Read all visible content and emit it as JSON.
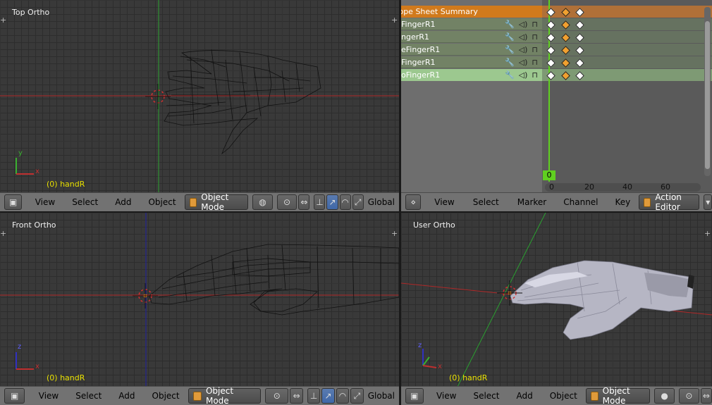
{
  "viewports": {
    "top_left": {
      "label": "Top Ortho",
      "object": "(0) handR",
      "axes": {
        "y": "y",
        "x": "x"
      }
    },
    "bottom_left": {
      "label": "Front Ortho",
      "object": "(0) handR",
      "axes": {
        "y": "z",
        "x": "x"
      }
    },
    "bottom_right": {
      "label": "User Ortho",
      "object": "(0) handR",
      "axes": {
        "y": "z",
        "x": "x"
      }
    }
  },
  "view3d_header": {
    "menus": [
      "View",
      "Select",
      "Add",
      "Object"
    ],
    "mode": "Object Mode",
    "orientation": "Global"
  },
  "dopesheet": {
    "summary": "Dope Sheet Summary",
    "channels": [
      "FingerR1",
      "ngerR1",
      "eFingerR1",
      "FingerR1",
      "oFingerR1"
    ],
    "selected_index": 4,
    "current_frame": "0",
    "ruler_ticks": [
      "0",
      "20",
      "40",
      "60"
    ],
    "header_menus": [
      "View",
      "Select",
      "Marker",
      "Channel",
      "Key"
    ],
    "editor": "Action Editor"
  },
  "colors": {
    "accent_orange": "#d17a1c",
    "channel_green": "#728265",
    "selected_green": "#9cc88f",
    "axis_x": "#c03030",
    "axis_y": "#3ab030",
    "axis_z": "#3030c0",
    "playhead": "#60d020",
    "object_label": "#e8e000"
  },
  "icons": {
    "editor_type": "cube-icon",
    "wrench": "wrench-icon",
    "speaker": "speaker-icon",
    "lock": "lock-icon"
  }
}
